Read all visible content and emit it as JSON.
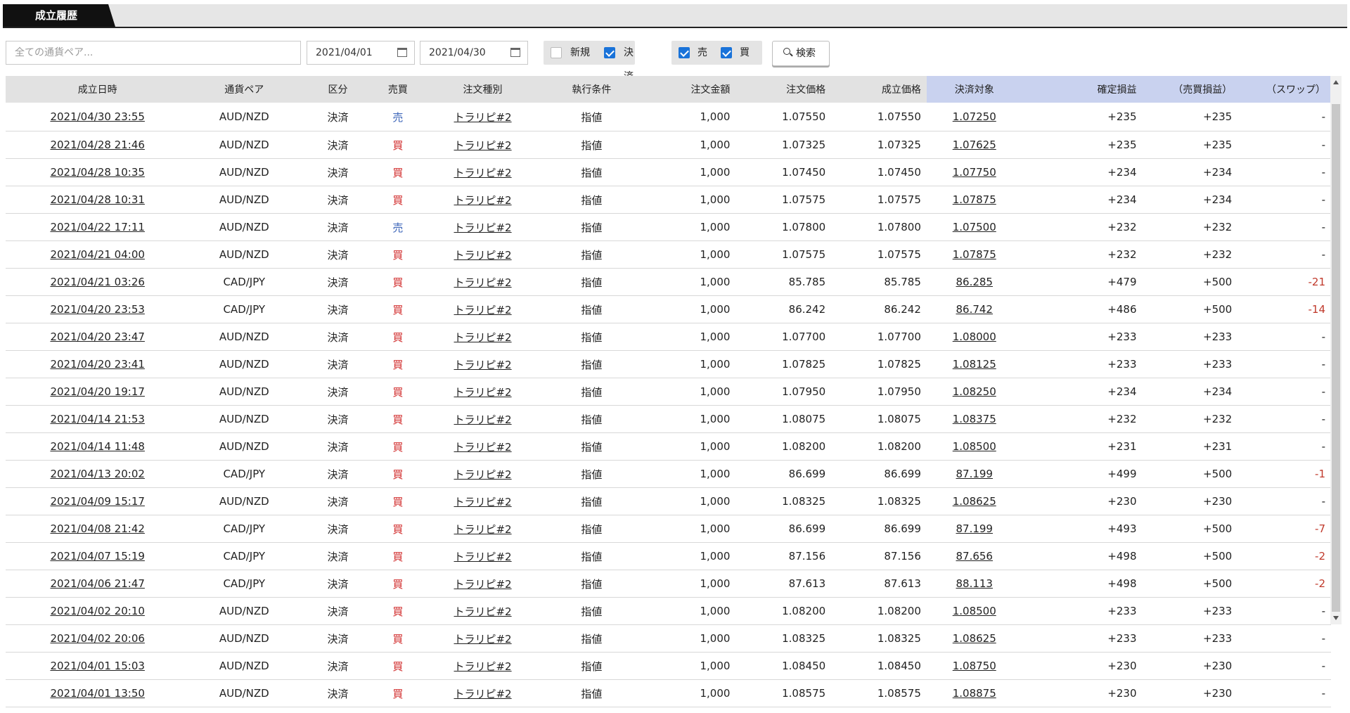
{
  "tab": {
    "label": "成立履歴"
  },
  "filters": {
    "pair_placeholder": "全ての通貨ペア...",
    "date_from": "2021/04/01",
    "date_to": "2021/04/30",
    "new_label": "新規",
    "new_checked": false,
    "settle_label": "決済",
    "settle_checked": true,
    "sell_label": "売",
    "sell_checked": true,
    "buy_label": "買",
    "buy_checked": true,
    "search_label": "検索"
  },
  "table": {
    "headers": [
      "成立日時",
      "通貨ペア",
      "区分",
      "売買",
      "注文種別",
      "執行条件",
      "注文金額",
      "注文価格",
      "成立価格",
      "決済対象",
      "確定損益",
      "（売買損益）",
      "（スワップ）"
    ],
    "rows": [
      [
        "2021/04/30 23:55",
        "AUD/NZD",
        "決済",
        "売",
        "トラリピ#2",
        "指値",
        "1,000",
        "1.07550",
        "1.07550",
        "1.07250",
        "+235",
        "+235",
        "-"
      ],
      [
        "2021/04/28 21:46",
        "AUD/NZD",
        "決済",
        "買",
        "トラリピ#2",
        "指値",
        "1,000",
        "1.07325",
        "1.07325",
        "1.07625",
        "+235",
        "+235",
        "-"
      ],
      [
        "2021/04/28 10:35",
        "AUD/NZD",
        "決済",
        "買",
        "トラリピ#2",
        "指値",
        "1,000",
        "1.07450",
        "1.07450",
        "1.07750",
        "+234",
        "+234",
        "-"
      ],
      [
        "2021/04/28 10:31",
        "AUD/NZD",
        "決済",
        "買",
        "トラリピ#2",
        "指値",
        "1,000",
        "1.07575",
        "1.07575",
        "1.07875",
        "+234",
        "+234",
        "-"
      ],
      [
        "2021/04/22 17:11",
        "AUD/NZD",
        "決済",
        "売",
        "トラリピ#2",
        "指値",
        "1,000",
        "1.07800",
        "1.07800",
        "1.07500",
        "+232",
        "+232",
        "-"
      ],
      [
        "2021/04/21 04:00",
        "AUD/NZD",
        "決済",
        "買",
        "トラリピ#2",
        "指値",
        "1,000",
        "1.07575",
        "1.07575",
        "1.07875",
        "+232",
        "+232",
        "-"
      ],
      [
        "2021/04/21 03:26",
        "CAD/JPY",
        "決済",
        "買",
        "トラリピ#2",
        "指値",
        "1,000",
        "85.785",
        "85.785",
        "86.285",
        "+479",
        "+500",
        "-21"
      ],
      [
        "2021/04/20 23:53",
        "CAD/JPY",
        "決済",
        "買",
        "トラリピ#2",
        "指値",
        "1,000",
        "86.242",
        "86.242",
        "86.742",
        "+486",
        "+500",
        "-14"
      ],
      [
        "2021/04/20 23:47",
        "AUD/NZD",
        "決済",
        "買",
        "トラリピ#2",
        "指値",
        "1,000",
        "1.07700",
        "1.07700",
        "1.08000",
        "+233",
        "+233",
        "-"
      ],
      [
        "2021/04/20 23:41",
        "AUD/NZD",
        "決済",
        "買",
        "トラリピ#2",
        "指値",
        "1,000",
        "1.07825",
        "1.07825",
        "1.08125",
        "+233",
        "+233",
        "-"
      ],
      [
        "2021/04/20 19:17",
        "AUD/NZD",
        "決済",
        "買",
        "トラリピ#2",
        "指値",
        "1,000",
        "1.07950",
        "1.07950",
        "1.08250",
        "+234",
        "+234",
        "-"
      ],
      [
        "2021/04/14 21:53",
        "AUD/NZD",
        "決済",
        "買",
        "トラリピ#2",
        "指値",
        "1,000",
        "1.08075",
        "1.08075",
        "1.08375",
        "+232",
        "+232",
        "-"
      ],
      [
        "2021/04/14 11:48",
        "AUD/NZD",
        "決済",
        "買",
        "トラリピ#2",
        "指値",
        "1,000",
        "1.08200",
        "1.08200",
        "1.08500",
        "+231",
        "+231",
        "-"
      ],
      [
        "2021/04/13 20:02",
        "CAD/JPY",
        "決済",
        "買",
        "トラリピ#2",
        "指値",
        "1,000",
        "86.699",
        "86.699",
        "87.199",
        "+499",
        "+500",
        "-1"
      ],
      [
        "2021/04/09 15:17",
        "AUD/NZD",
        "決済",
        "買",
        "トラリピ#2",
        "指値",
        "1,000",
        "1.08325",
        "1.08325",
        "1.08625",
        "+230",
        "+230",
        "-"
      ],
      [
        "2021/04/08 21:42",
        "CAD/JPY",
        "決済",
        "買",
        "トラリピ#2",
        "指値",
        "1,000",
        "86.699",
        "86.699",
        "87.199",
        "+493",
        "+500",
        "-7"
      ],
      [
        "2021/04/07 15:19",
        "CAD/JPY",
        "決済",
        "買",
        "トラリピ#2",
        "指値",
        "1,000",
        "87.156",
        "87.156",
        "87.656",
        "+498",
        "+500",
        "-2"
      ],
      [
        "2021/04/06 21:47",
        "CAD/JPY",
        "決済",
        "買",
        "トラリピ#2",
        "指値",
        "1,000",
        "87.613",
        "87.613",
        "88.113",
        "+498",
        "+500",
        "-2"
      ],
      [
        "2021/04/02 20:10",
        "AUD/NZD",
        "決済",
        "買",
        "トラリピ#2",
        "指値",
        "1,000",
        "1.08200",
        "1.08200",
        "1.08500",
        "+233",
        "+233",
        "-"
      ],
      [
        "2021/04/02 20:06",
        "AUD/NZD",
        "決済",
        "買",
        "トラリピ#2",
        "指値",
        "1,000",
        "1.08325",
        "1.08325",
        "1.08625",
        "+233",
        "+233",
        "-"
      ],
      [
        "2021/04/01 15:03",
        "AUD/NZD",
        "決済",
        "買",
        "トラリピ#2",
        "指値",
        "1,000",
        "1.08450",
        "1.08450",
        "1.08750",
        "+230",
        "+230",
        "-"
      ],
      [
        "2021/04/01 13:50",
        "AUD/NZD",
        "決済",
        "買",
        "トラリピ#2",
        "指値",
        "1,000",
        "1.08575",
        "1.08575",
        "1.08875",
        "+230",
        "+230",
        "-"
      ]
    ]
  },
  "colors": {
    "sell": "#3a63b8",
    "buy": "#d12b2b",
    "negative": "#c0392b",
    "header_highlight": "#c9d2ef",
    "checkbox": "#1a73d9"
  }
}
